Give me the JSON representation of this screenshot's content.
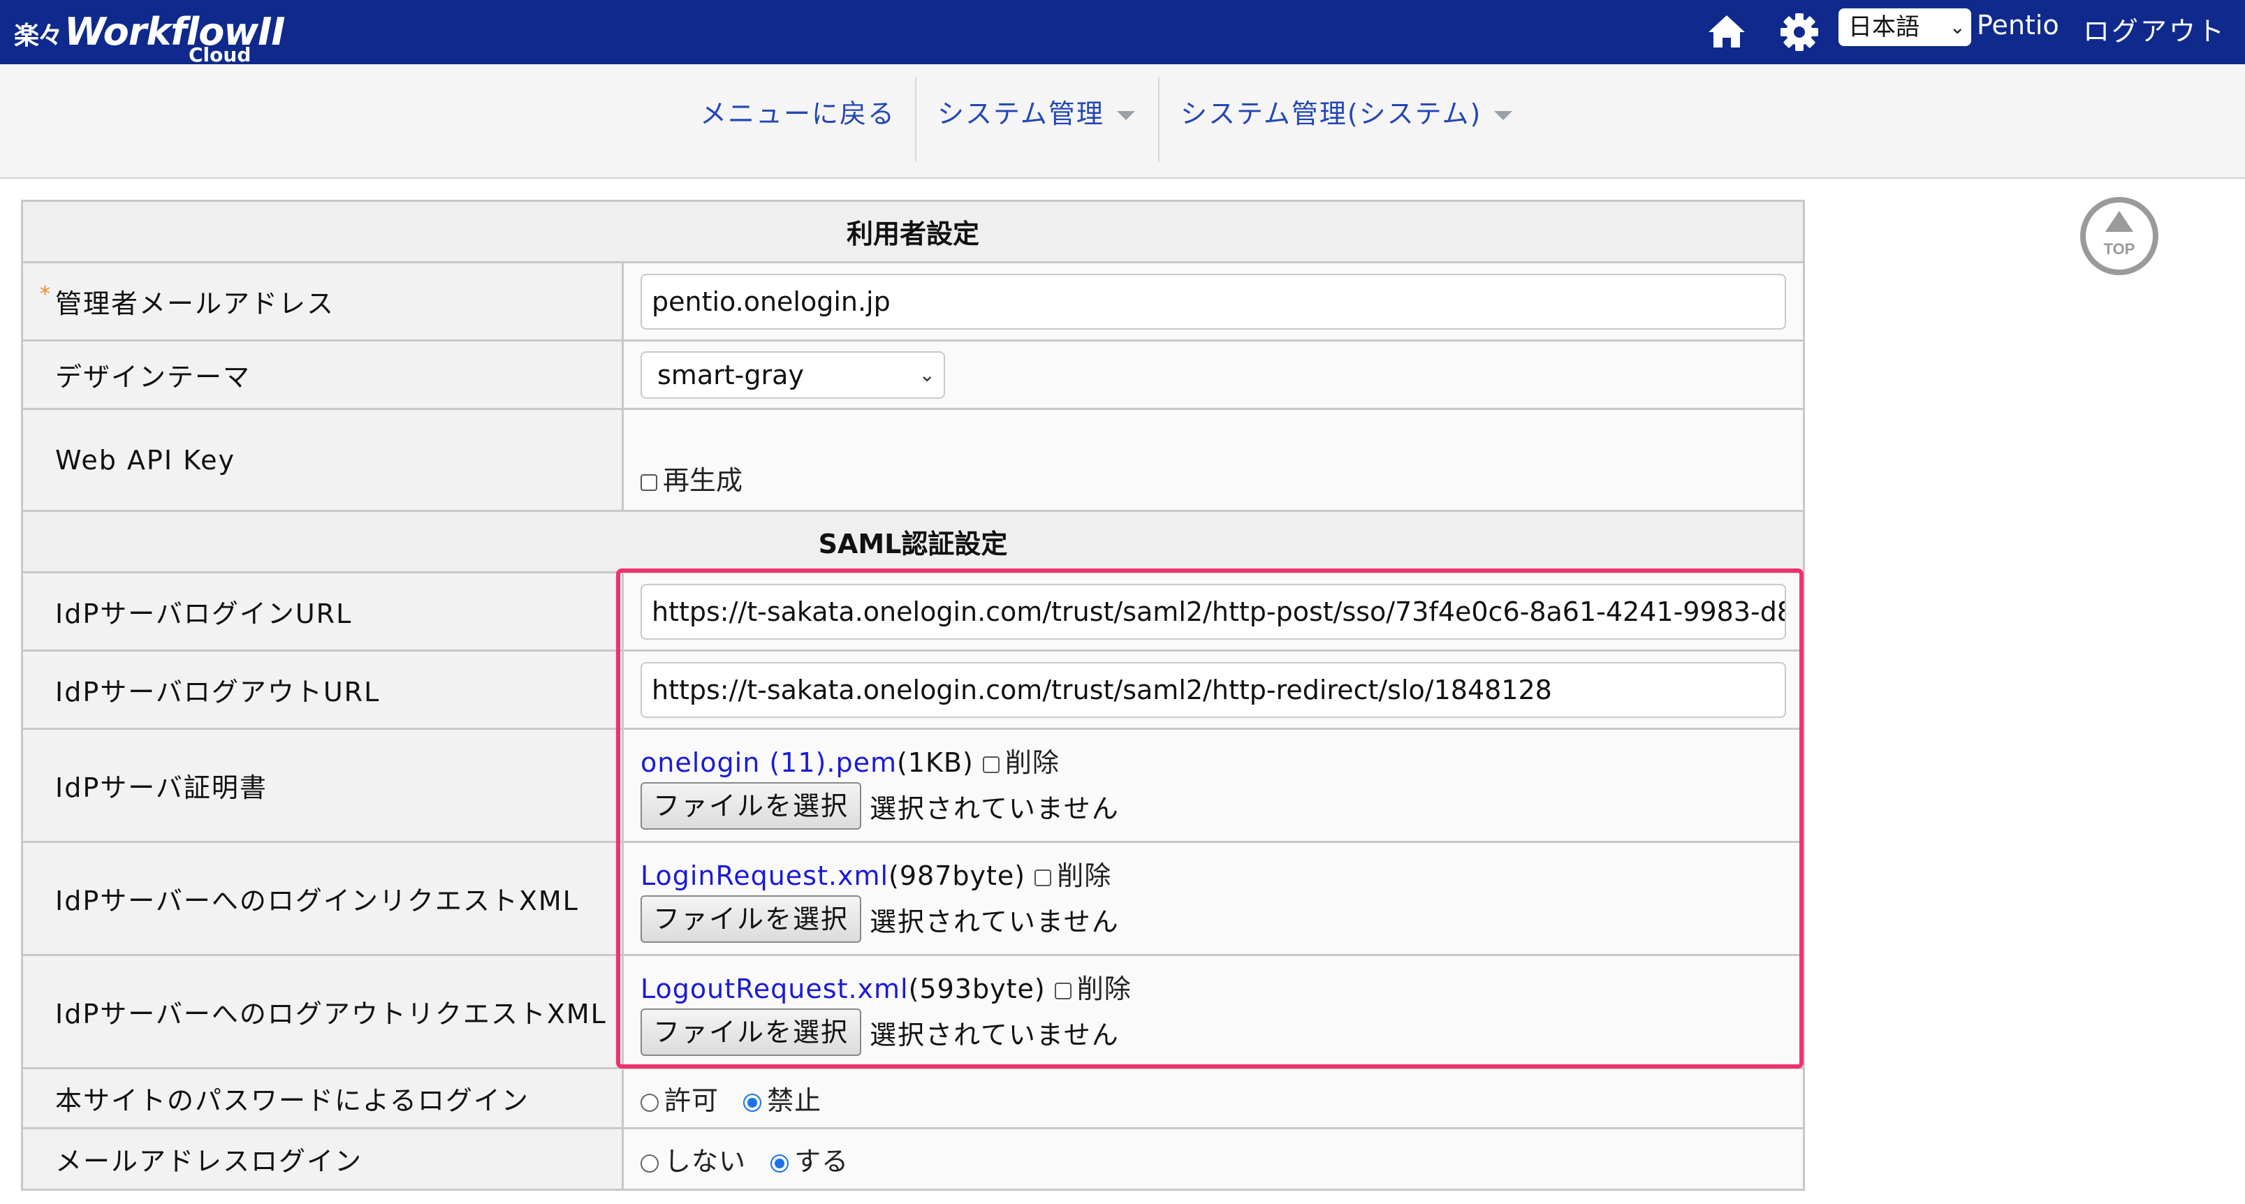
{
  "header": {
    "logo_kanji": "楽々",
    "logo_main": "WorkflowII",
    "logo_sub": "Cloud",
    "language": "日本語",
    "user_name": "Pentio",
    "logout": "ログアウト",
    "icons": [
      "home-icon",
      "gear-icon",
      "chevron-down-icon"
    ]
  },
  "nav": {
    "back": "メニューに戻る",
    "system_admin": "システム管理",
    "system_admin_system": "システム管理(システム)"
  },
  "user_settings": {
    "section_title": "利用者設定",
    "admin_email_label": "管理者メールアドレス",
    "admin_email_value": "pentio.onelogin.jp",
    "design_theme_label": "デザインテーマ",
    "design_theme_value": "smart-gray",
    "web_api_key_label": "Web API Key",
    "regenerate_label": "再生成"
  },
  "saml": {
    "section_title": "SAML認証設定",
    "login_url_label": "IdPサーバログインURL",
    "login_url_value": "https://t-sakata.onelogin.com/trust/saml2/http-post/sso/73f4e0c6-8a61-4241-9983-d8",
    "logout_url_label": "IdPサーバログアウトURL",
    "logout_url_value": "https://t-sakata.onelogin.com/trust/saml2/http-redirect/slo/1848128",
    "cert_label": "IdPサーバ証明書",
    "cert_file": "onelogin (11).pem",
    "cert_size": "(1KB)",
    "login_xml_label": "IdPサーバーへのログインリクエストXML",
    "login_xml_file": "LoginRequest.xml",
    "login_xml_size": "(987byte)",
    "logout_xml_label": "IdPサーバーへのログアウトリクエストXML",
    "logout_xml_file": "LogoutRequest.xml",
    "logout_xml_size": "(593byte)",
    "delete_label": "削除",
    "choose_file": "ファイルを選択",
    "no_file_selected": "選択されていません"
  },
  "login_options": {
    "password_login_label": "本サイトのパスワードによるログイン",
    "allow": "許可",
    "deny": "禁止",
    "password_login_selected": "禁止",
    "email_login_label": "メールアドレスログイン",
    "no": "しない",
    "yes": "する",
    "email_login_selected": "する"
  },
  "top_button": "TOP",
  "colors": {
    "header_bg": "#0f2a8c",
    "nav_link": "#2447b3",
    "highlight": "#f0326e",
    "file_link": "#1a1ad8",
    "required_mark": "#f08a24"
  }
}
